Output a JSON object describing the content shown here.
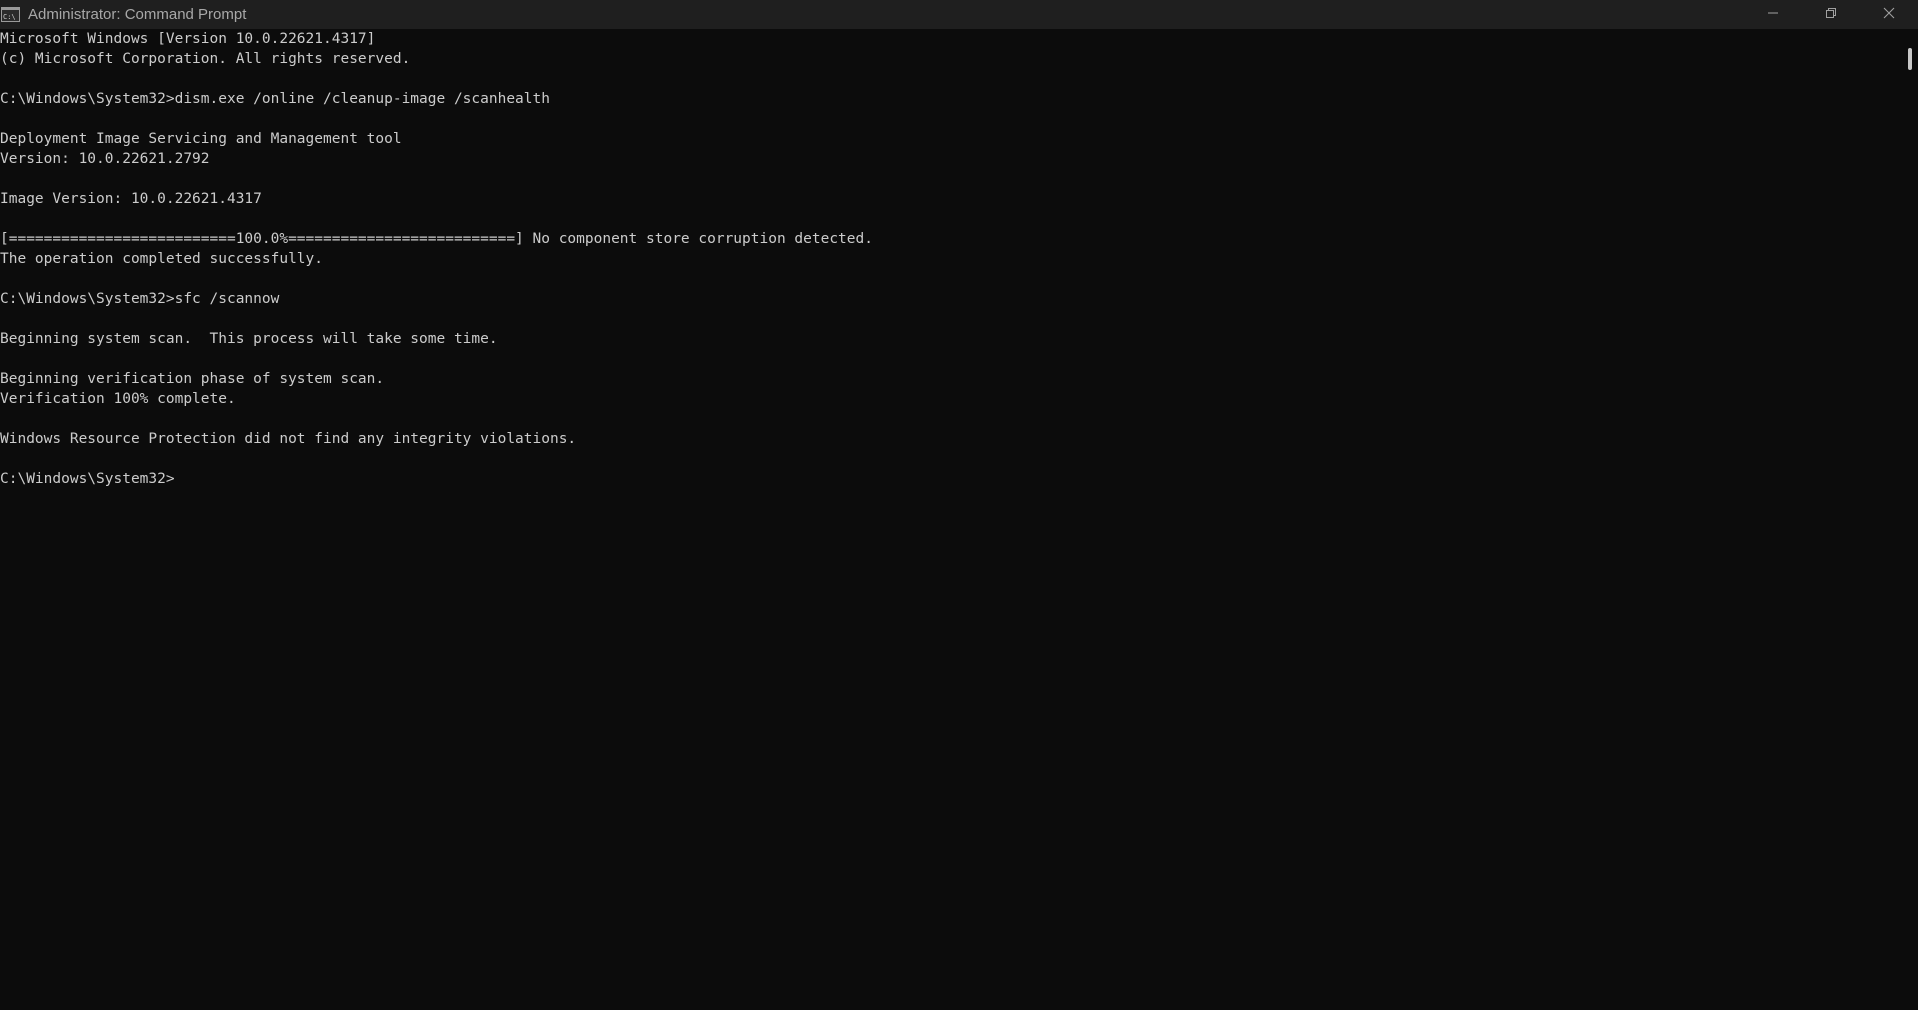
{
  "window": {
    "title": "Administrator: Command Prompt"
  },
  "console": {
    "lines": [
      "Microsoft Windows [Version 10.0.22621.4317]",
      "(c) Microsoft Corporation. All rights reserved.",
      "",
      "C:\\Windows\\System32>dism.exe /online /cleanup-image /scanhealth",
      "",
      "Deployment Image Servicing and Management tool",
      "Version: 10.0.22621.2792",
      "",
      "Image Version: 10.0.22621.4317",
      "",
      "[==========================100.0%==========================] No component store corruption detected.",
      "The operation completed successfully.",
      "",
      "C:\\Windows\\System32>sfc /scannow",
      "",
      "Beginning system scan.  This process will take some time.",
      "",
      "Beginning verification phase of system scan.",
      "Verification 100% complete.",
      "",
      "Windows Resource Protection did not find any integrity violations.",
      "",
      "C:\\Windows\\System32>"
    ]
  },
  "icons": {
    "app": "command-prompt-icon",
    "minimize": "minimize-icon",
    "maximize": "restore-icon",
    "close": "close-icon"
  },
  "colors": {
    "background": "#0c0c0c",
    "titlebar": "#1f1f1f",
    "text": "#cccccc"
  }
}
